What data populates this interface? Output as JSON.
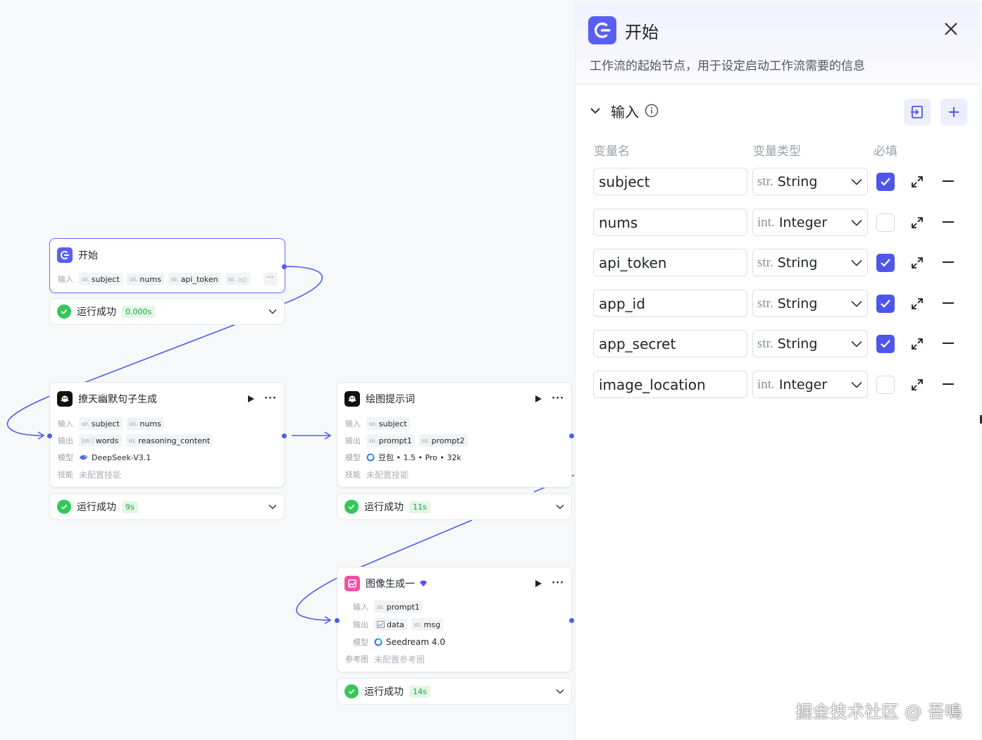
{
  "colors": {
    "accent": "#4e56ea",
    "edge": "#4e5bf2",
    "success": "#34c759"
  },
  "canvas": {
    "start_node": {
      "title": "开始",
      "input_label": "输入",
      "inputs": [
        {
          "type": "str.",
          "name": "subject"
        },
        {
          "type": "int.",
          "name": "nums"
        },
        {
          "type": "str.",
          "name": "api_token"
        },
        {
          "type": "str.",
          "name": "ap"
        }
      ],
      "more": "···",
      "status": {
        "text": "运行成功",
        "time": "0.000s"
      }
    },
    "node_sentence": {
      "title": "撩天幽默句子生成",
      "input_label": "输入",
      "inputs": [
        {
          "type": "str.",
          "name": "subject"
        },
        {
          "type": "int.",
          "name": "nums"
        }
      ],
      "output_label": "输出",
      "outputs": [
        {
          "type": "[str.]",
          "name": "words"
        },
        {
          "type": "str.",
          "name": "reasoning_content"
        }
      ],
      "model_label": "模型",
      "model": "DeepSeek-V3.1",
      "skill_label": "技能",
      "skill": "未配置技能",
      "status": {
        "text": "运行成功",
        "time": "9s"
      }
    },
    "node_prompt": {
      "title": "绘图提示词",
      "input_label": "输入",
      "inputs": [
        {
          "type": "str.",
          "name": "subject"
        }
      ],
      "output_label": "输出",
      "outputs": [
        {
          "type": "str.",
          "name": "prompt1"
        },
        {
          "type": "str.",
          "name": "prompt2"
        }
      ],
      "model_label": "模型",
      "model": "豆包 • 1.5 • Pro • 32k",
      "skill_label": "技能",
      "skill": "未配置技能",
      "status": {
        "text": "运行成功",
        "time": "11s"
      }
    },
    "node_image": {
      "title": "图像生成一",
      "input_label": "输入",
      "inputs": [
        {
          "type": "str.",
          "name": "prompt1"
        }
      ],
      "output_label": "输出",
      "outputs": [
        {
          "type": "img",
          "name": "data"
        },
        {
          "type": "str.",
          "name": "msg"
        }
      ],
      "model_label": "模型",
      "model": "Seedream 4.0",
      "ref_label": "参考图",
      "ref": "未配置参考图",
      "status": {
        "text": "运行成功",
        "time": "14s"
      }
    }
  },
  "panel": {
    "title": "开始",
    "description": "工作流的起始节点，用于设定启动工作流需要的信息",
    "section_title": "输入",
    "columns": {
      "name": "变量名",
      "type": "变量类型",
      "required": "必填"
    },
    "variables": [
      {
        "name": "subject",
        "type_prefix": "str.",
        "type": "String",
        "required": true
      },
      {
        "name": "nums",
        "type_prefix": "int.",
        "type": "Integer",
        "required": false
      },
      {
        "name": "api_token",
        "type_prefix": "str.",
        "type": "String",
        "required": true
      },
      {
        "name": "app_id",
        "type_prefix": "str.",
        "type": "String",
        "required": true
      },
      {
        "name": "app_secret",
        "type_prefix": "str.",
        "type": "String",
        "required": true
      },
      {
        "name": "image_location",
        "type_prefix": "int.",
        "type": "Integer",
        "required": false
      }
    ]
  },
  "watermark": "掘金技术社区 @ 吾鳴"
}
